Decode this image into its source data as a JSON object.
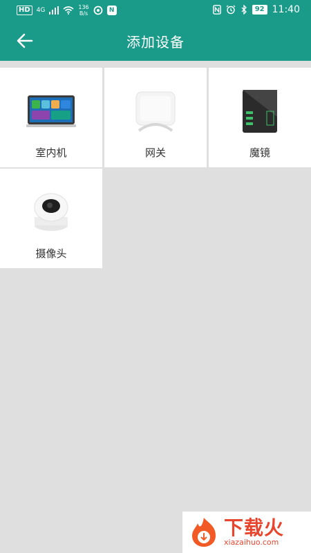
{
  "status_bar": {
    "hd": "HD",
    "network": "4G",
    "speed_value": "136",
    "speed_unit": "B/s",
    "app_badge": "N",
    "battery": "92",
    "time": "11:40"
  },
  "header": {
    "title": "添加设备",
    "back_icon": "arrow-left-icon"
  },
  "devices": [
    {
      "label": "室内机",
      "icon": "indoor-panel-image"
    },
    {
      "label": "网关",
      "icon": "gateway-image"
    },
    {
      "label": "魔镜",
      "icon": "magic-mirror-image"
    },
    {
      "label": "摄像头",
      "icon": "camera-image"
    }
  ],
  "watermark": {
    "brand": "下载火",
    "url": "xiazaihuo.com"
  },
  "colors": {
    "primary": "#1a9b8a",
    "background": "#dfdfdf",
    "watermark": "#e8452e"
  }
}
